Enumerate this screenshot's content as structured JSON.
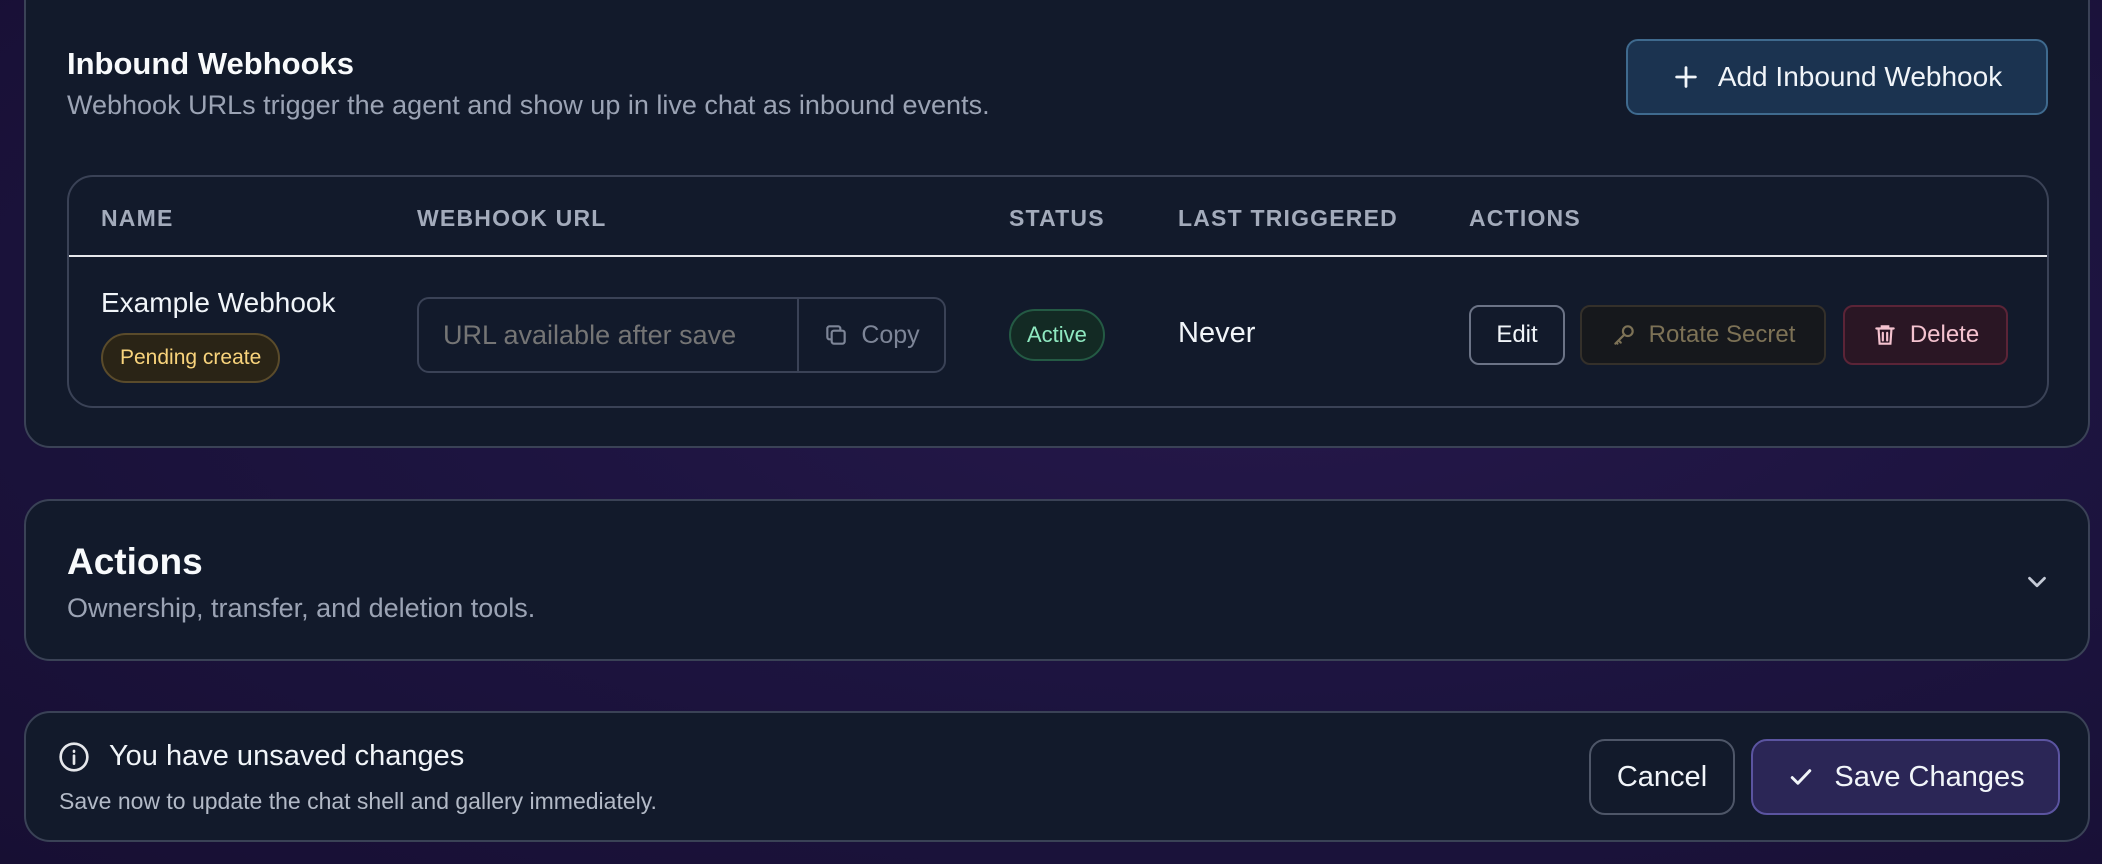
{
  "inbound_webhooks": {
    "title": "Inbound Webhooks",
    "subtitle": "Webhook URLs trigger the agent and show up in live chat as inbound events.",
    "add_button_label": "Add Inbound Webhook",
    "table": {
      "columns": [
        "NAME",
        "WEBHOOK URL",
        "STATUS",
        "LAST TRIGGERED",
        "ACTIONS"
      ],
      "rows": [
        {
          "name": "Example Webhook",
          "badge": "Pending create",
          "url_placeholder": "URL available after save",
          "copy_label": "Copy",
          "status": "Active",
          "last_triggered": "Never",
          "actions": {
            "edit": "Edit",
            "rotate": "Rotate Secret",
            "delete": "Delete"
          }
        }
      ]
    }
  },
  "actions_section": {
    "title": "Actions",
    "subtitle": "Ownership, transfer, and deletion tools."
  },
  "unsaved_bar": {
    "title": "You have unsaved changes",
    "subtitle": "Save now to update the chat shell and gallery immediately.",
    "cancel_label": "Cancel",
    "save_label": "Save Changes"
  },
  "icons": {
    "add": "plus-icon",
    "copy": "copy-icon",
    "rotate": "key-icon",
    "delete": "trash-icon",
    "expand": "chevron-down-icon",
    "info": "info-icon",
    "save": "check-icon"
  },
  "colors": {
    "card_background": "#121a2b",
    "pending_badge": "#f9d47c",
    "active_badge": "#8fe8c0",
    "delete_accent": "#f4c2cf",
    "save_button": "#2b2656"
  }
}
